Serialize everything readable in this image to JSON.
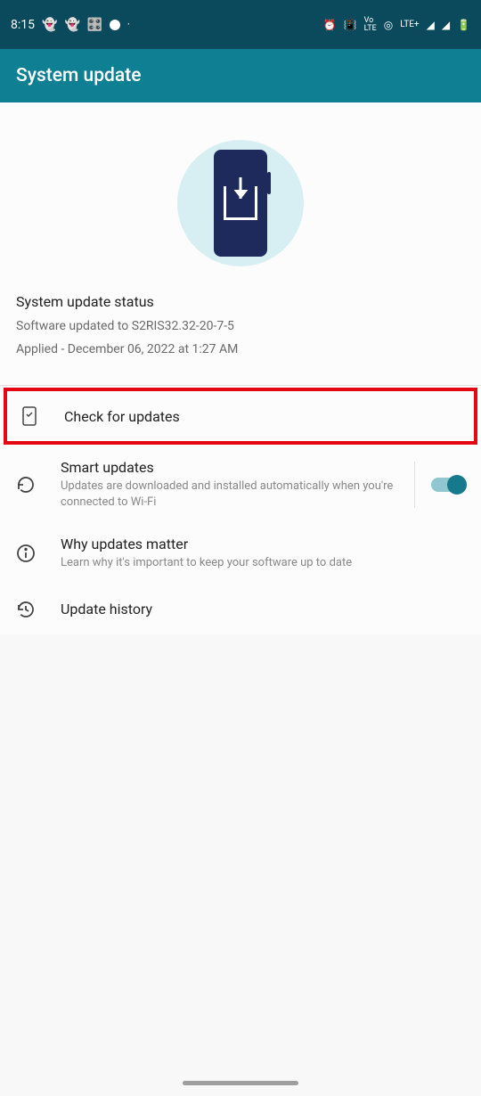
{
  "statusBar": {
    "time": "8:15",
    "lteLabel": "LTE+"
  },
  "appBar": {
    "title": "System update"
  },
  "status": {
    "heading": "System update status",
    "softwareLine": "Software updated to S2RIS32.32-20-7-5",
    "appliedLine": "Applied - December 06, 2022 at 1:27 AM"
  },
  "checkUpdates": {
    "title": "Check for updates"
  },
  "smartUpdates": {
    "title": "Smart updates",
    "desc": "Updates are downloaded and installed automatically when you're connected to Wi-Fi",
    "enabled": true
  },
  "whyUpdates": {
    "title": "Why updates matter",
    "desc": "Learn why it's important to keep your software up to date"
  },
  "history": {
    "title": "Update history"
  }
}
